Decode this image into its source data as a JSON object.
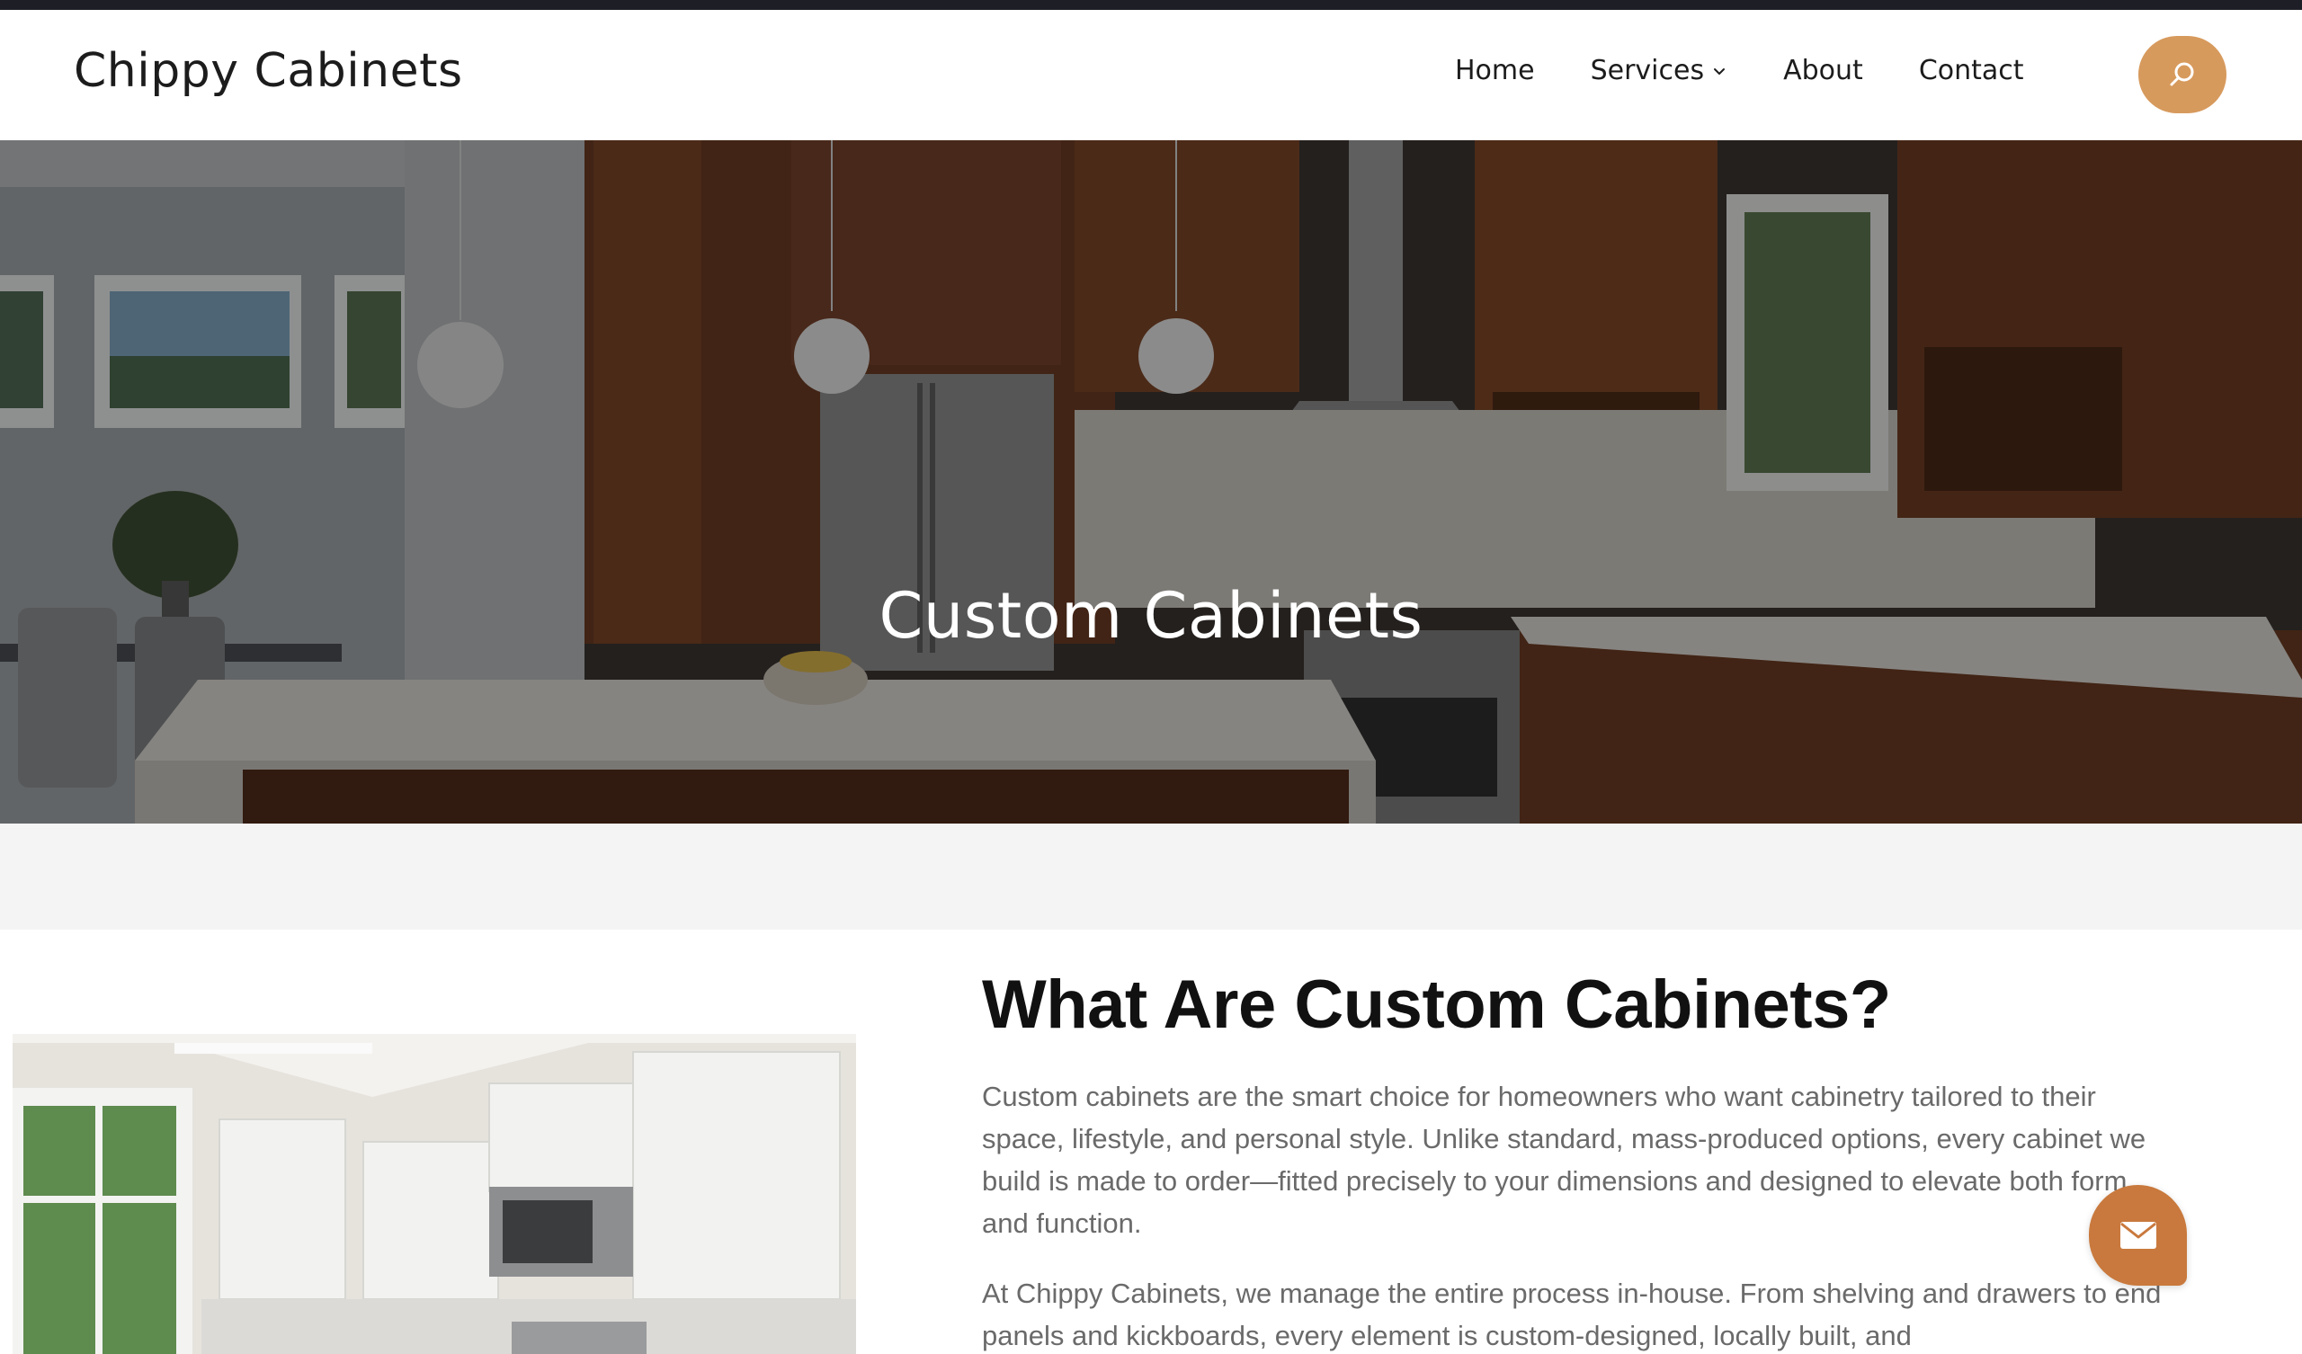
{
  "site": {
    "brand": "Chippy Cabinets"
  },
  "nav": {
    "items": [
      {
        "label": "Home"
      },
      {
        "label": "Services"
      },
      {
        "label": "About"
      },
      {
        "label": "Contact"
      }
    ],
    "search_icon": "search-icon"
  },
  "hero": {
    "title": "Custom Cabinets"
  },
  "content": {
    "heading": "What Are Custom Cabinets?",
    "paragraph_1": "Custom cabinets are the smart choice for homeowners who want cabinetry tailored to their space, lifestyle, and personal style. Unlike standard, mass-produced options, every cabinet we build is made to order—fitted precisely to your dimensions and designed to elevate both form and function.",
    "paragraph_2": "At Chippy Cabinets, we manage the entire process in-house. From shelving and drawers to end panels and kickboards, every element is custom-designed, locally built, and"
  },
  "contact_fab": {
    "icon": "envelope-icon"
  },
  "colors": {
    "accent": "#d79a5d",
    "fab": "#c9793d",
    "topbar": "#1e1f26",
    "body_text": "#6a6a6a"
  }
}
